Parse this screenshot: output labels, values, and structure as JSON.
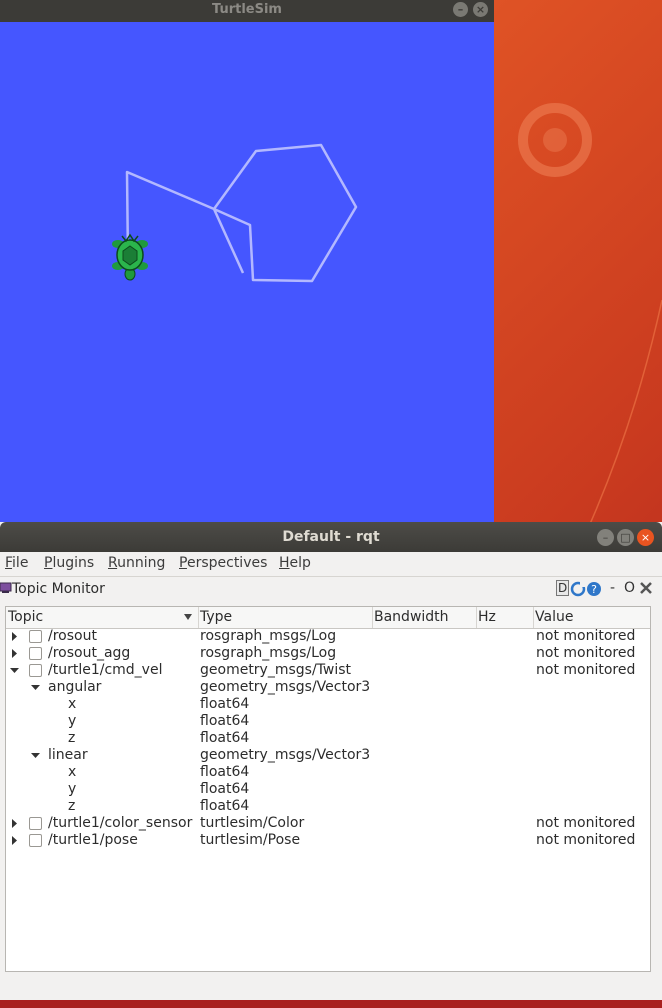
{
  "turtlesim": {
    "title": "TurtleSim",
    "background_color": "#4556ff",
    "pen_color": "#b3b8ff",
    "turtle_icon": "turtle-icon"
  },
  "desktop": {
    "accent_color": "#e95420",
    "logo_icon": "ubuntu-circle-icon"
  },
  "rqt": {
    "title": "Default - rqt",
    "menu": [
      {
        "label": "File"
      },
      {
        "label": "Plugins"
      },
      {
        "label": "Running"
      },
      {
        "label": "Perspectives"
      },
      {
        "label": "Help"
      }
    ],
    "plugin_title": "Topic Monitor",
    "plugin_controls": {
      "d_label": "D",
      "o_label": "O",
      "dash_label": "-"
    },
    "columns": [
      "Topic",
      "Type",
      "Bandwidth",
      "Hz",
      "Value"
    ],
    "rows": [
      {
        "topic": "/rosout",
        "type": "rosgraph_msgs/Log",
        "value": "not monitored"
      },
      {
        "topic": "/rosout_agg",
        "type": "rosgraph_msgs/Log",
        "value": "not monitored"
      },
      {
        "topic": "/turtle1/cmd_vel",
        "type": "geometry_msgs/Twist",
        "value": "not monitored"
      },
      {
        "topic": "angular",
        "type": "geometry_msgs/Vector3",
        "value": ""
      },
      {
        "topic": "x",
        "type": "float64",
        "value": ""
      },
      {
        "topic": "y",
        "type": "float64",
        "value": ""
      },
      {
        "topic": "z",
        "type": "float64",
        "value": ""
      },
      {
        "topic": "linear",
        "type": "geometry_msgs/Vector3",
        "value": ""
      },
      {
        "topic": "x",
        "type": "float64",
        "value": ""
      },
      {
        "topic": "y",
        "type": "float64",
        "value": ""
      },
      {
        "topic": "z",
        "type": "float64",
        "value": ""
      },
      {
        "topic": "/turtle1/color_sensor",
        "type": "turtlesim/Color",
        "value": "not monitored"
      },
      {
        "topic": "/turtle1/pose",
        "type": "turtlesim/Pose",
        "value": "not monitored"
      }
    ]
  }
}
